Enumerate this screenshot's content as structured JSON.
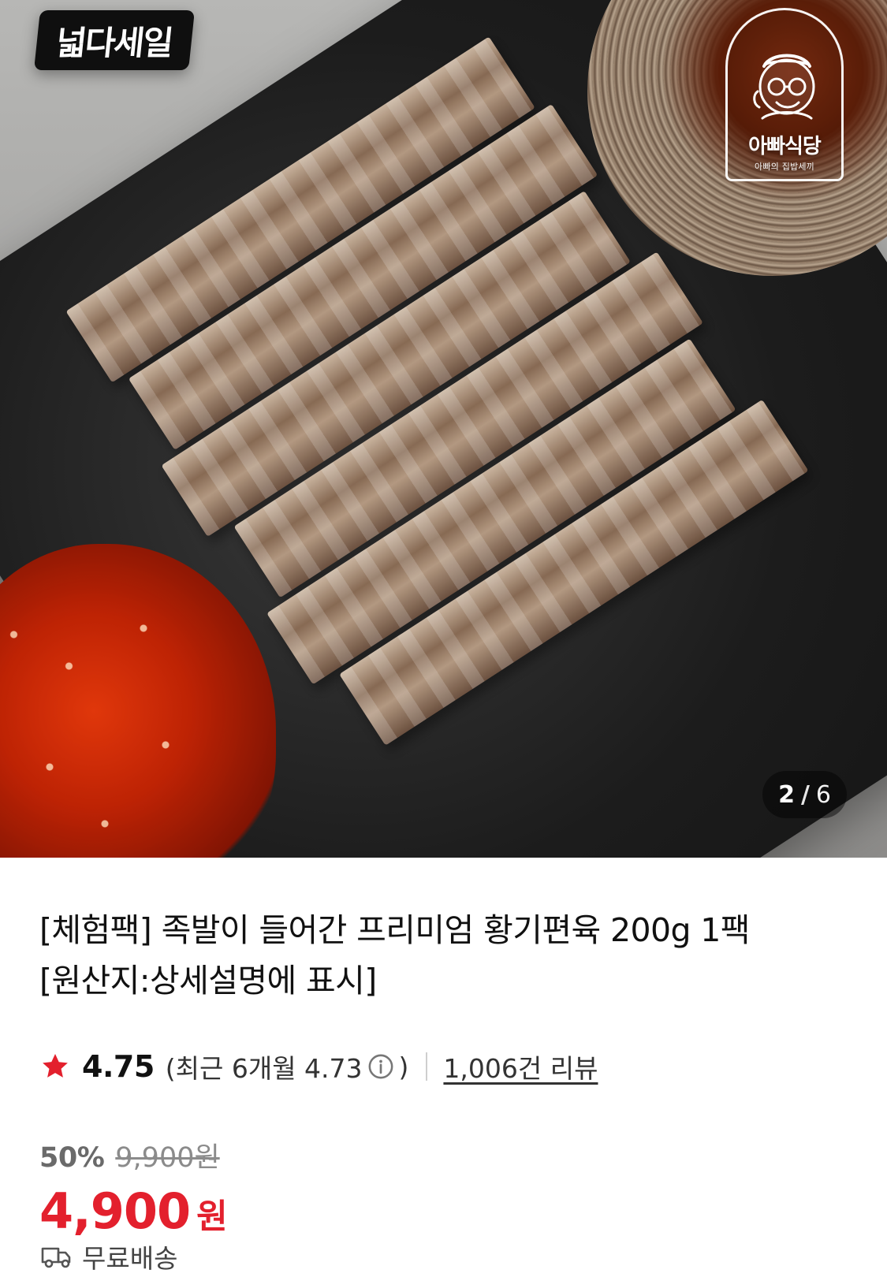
{
  "badges": {
    "sale": "넓다세일"
  },
  "brand": {
    "name": "아빠식당",
    "tagline": "아빠의 집밥세끼"
  },
  "gallery": {
    "current": "2",
    "separator": "/",
    "total": "6"
  },
  "product": {
    "title": "[체험팩] 족발이 들어간 프리미엄 황기편육 200g 1팩\n[원산지:상세설명에 표시]",
    "rating": "4.75",
    "recent_open": "(최근 6개월 4.73",
    "recent_close": ")",
    "reviews": "1,006건 리뷰",
    "discount_percent": "50%",
    "original_price": "9,900원",
    "sale_price": "4,900",
    "sale_unit": "원",
    "shipping": "무료배송"
  },
  "colors": {
    "accent_red": "#e3202d",
    "text_primary": "#111111",
    "text_secondary": "#333333",
    "muted": "#8b8b8b"
  },
  "icons": {
    "star": "star-icon",
    "info": "info-circle-icon",
    "shipping": "truck-icon"
  }
}
